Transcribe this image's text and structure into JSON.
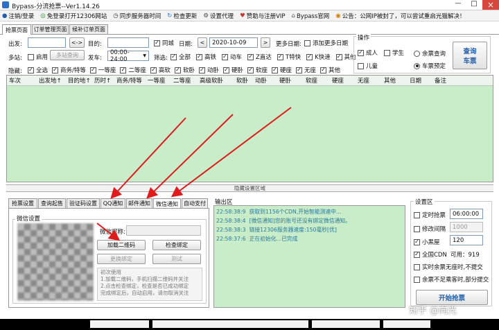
{
  "window": {
    "title": "Bypass-分流抢票--Ver1.14.26",
    "min_glyph": "—",
    "max_glyph": "□",
    "close_glyph": "×"
  },
  "menu": [
    "注销/登录",
    "免登录打开12306网站",
    "同步服务器时间",
    "检查更新",
    "设置代理",
    "赞助与注册VIP",
    "Bypass官网",
    "公告：公网IP被封了，可以尝试重启光猫解决！"
  ],
  "main_tabs": [
    "抢票页面",
    "订单管理页面",
    "候补订单页面"
  ],
  "form": {
    "from_label": "出发:",
    "swap_label": "<->",
    "to_label": "目的:",
    "same_city": "同城",
    "date_label": "日期:",
    "prev": "<",
    "next": ">",
    "date_value": "2020-10-09",
    "more_dates": "更多日期:",
    "add_dates": "添加更多日期",
    "multi_station": "多站:",
    "enable": "启用",
    "multi_query": "多站查询",
    "depart_label": "发车:",
    "depart_value": "00:00-24:00",
    "filter_label": "筛选:",
    "train_types": [
      "全部",
      "高铁",
      "动车",
      "Z直达",
      "T特快",
      "K快速",
      "其他"
    ],
    "hide_label": "隐藏:",
    "seat_types": [
      "全选",
      "商务/特等",
      "一等座",
      "二等座",
      "高软",
      "软卧",
      "动卧",
      "硬卧",
      "软座",
      "硬座",
      "无座",
      "其他"
    ]
  },
  "ops": {
    "title": "操作",
    "adult": "成人",
    "student": "学生",
    "child": "儿童",
    "remain": "余票查询",
    "booking": "车票预定",
    "query_btn_1": "查询",
    "query_btn_2": "车票"
  },
  "table_headers": [
    "车次",
    "出发地↑",
    "目的地↑",
    "历时↑",
    "商务/特等",
    "一等座",
    "二等座",
    "高级软卧",
    "软卧",
    "动卧",
    "硬卧",
    "软座",
    "硬座",
    "无座",
    "其他",
    "日期",
    "备注"
  ],
  "hidden_area": "隐藏设置区域",
  "sub_tabs": [
    "抢票设置",
    "查询起售",
    "验证码设置",
    "QQ通知",
    "邮件通知",
    "微信通知",
    "自动支付"
  ],
  "wechat": {
    "group": "微信设置",
    "nick_label": "微信昵称:",
    "load_qr": "加载二维码",
    "check_bind": "检查绑定",
    "change_bind": "更换绑定",
    "test": "测试",
    "help_title": "初次使用",
    "help_lines": [
      "1.加载二维码，手机扫描二维码并关注",
      "2.点击检查绑定，检查是否已成功绑定",
      "完成绑定后，自动启用，请勿取消关注"
    ]
  },
  "output": {
    "title": "输出区",
    "lines": [
      {
        "time": "22:58:38:9",
        "text": "获取到1156个CDN,开始智能测速中..."
      },
      {
        "time": "22:58:38:4",
        "text": "[微信通知]您的账号还没有绑定微信通知。"
      },
      {
        "time": "22:58:38:3",
        "text": "链接12306服务器速度:150毫秒[优]"
      },
      {
        "time": "22:58:37:6",
        "text": "正在初始化...已完成"
      }
    ]
  },
  "settings": {
    "title": "设置区",
    "timed": "定时抢票",
    "timed_value": "06:00:00",
    "interval": "修改间隔",
    "interval_value": "1000",
    "blackroom": "小黑屋",
    "blackroom_value": "120",
    "cdn": "全国CDN",
    "cdn_avail": "可用：919",
    "realtime": "实时余票无座时,不提交",
    "partial": "余票不足乘客时,部分提交",
    "start_btn": "开始抢票"
  },
  "watermark": "知乎 @向光",
  "icons": {
    "logout": "person-icon",
    "browser": "globe-icon",
    "sync": "clock-icon",
    "update": "update-icon",
    "proxy": "gear-icon",
    "sponsor": "heart-icon",
    "site": "home-icon",
    "notice": "notice-icon"
  }
}
